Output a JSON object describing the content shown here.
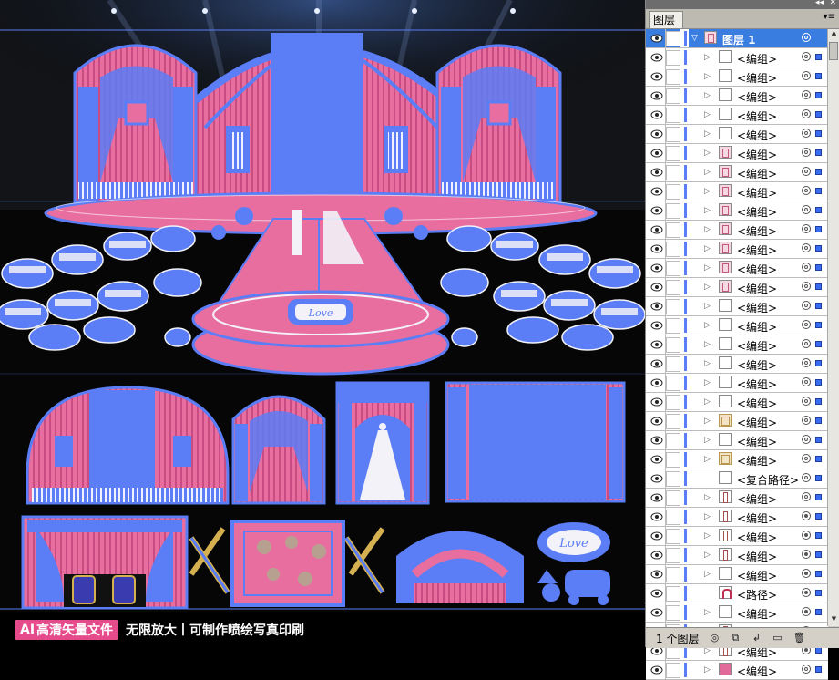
{
  "banner": {
    "badge_ai": "AI",
    "badge_text": "高清矢量文件",
    "slogan": "无限放大丨可制作喷绘写真印刷"
  },
  "colors": {
    "pink": "#e86ea0",
    "blue": "#5b7df5",
    "white": "#f2f2f8",
    "selection": "#3a7de0"
  },
  "panel": {
    "tab_label": "图层",
    "layer_count": "1 个图层",
    "selected_layer": {
      "name": "图层 1"
    },
    "rows": [
      {
        "name": "<编组>",
        "thumb": "blank",
        "expand": true,
        "target": "empty"
      },
      {
        "name": "<编组>",
        "thumb": "blank",
        "expand": true,
        "target": "empty"
      },
      {
        "name": "<编组>",
        "thumb": "blank",
        "expand": true,
        "target": "empty"
      },
      {
        "name": "<编组>",
        "thumb": "blank",
        "expand": true,
        "target": "empty"
      },
      {
        "name": "<编组>",
        "thumb": "blank",
        "expand": true,
        "target": "empty"
      },
      {
        "name": "<编组>",
        "thumb": "pink",
        "expand": true,
        "target": "empty"
      },
      {
        "name": "<编组>",
        "thumb": "pink",
        "expand": true,
        "target": "empty"
      },
      {
        "name": "<编组>",
        "thumb": "pink",
        "expand": true,
        "target": "empty"
      },
      {
        "name": "<编组>",
        "thumb": "pink",
        "expand": true,
        "target": "empty"
      },
      {
        "name": "<编组>",
        "thumb": "pink",
        "expand": true,
        "target": "empty"
      },
      {
        "name": "<编组>",
        "thumb": "pink",
        "expand": true,
        "target": "empty"
      },
      {
        "name": "<编组>",
        "thumb": "pink",
        "expand": true,
        "target": "empty"
      },
      {
        "name": "<编组>",
        "thumb": "pink",
        "expand": true,
        "target": "empty"
      },
      {
        "name": "<编组>",
        "thumb": "blank",
        "expand": true,
        "target": "empty"
      },
      {
        "name": "<编组>",
        "thumb": "blank",
        "expand": true,
        "target": "empty"
      },
      {
        "name": "<编组>",
        "thumb": "blank",
        "expand": true,
        "target": "empty"
      },
      {
        "name": "<编组>",
        "thumb": "blank",
        "expand": true,
        "target": "empty"
      },
      {
        "name": "<编组>",
        "thumb": "blank",
        "expand": true,
        "target": "empty"
      },
      {
        "name": "<编组>",
        "thumb": "blank",
        "expand": true,
        "target": "empty"
      },
      {
        "name": "<编组>",
        "thumb": "tan",
        "expand": true,
        "target": "empty"
      },
      {
        "name": "<编组>",
        "thumb": "blank",
        "expand": true,
        "target": "empty"
      },
      {
        "name": "<编组>",
        "thumb": "tan",
        "expand": true,
        "target": "empty"
      },
      {
        "name": "<复合路径>",
        "thumb": "blank",
        "expand": false,
        "target": "empty"
      },
      {
        "name": "<编组>",
        "thumb": "outline",
        "expand": true,
        "target": "empty"
      },
      {
        "name": "<编组>",
        "thumb": "outline",
        "expand": true,
        "target": "filled"
      },
      {
        "name": "<编组>",
        "thumb": "outline",
        "expand": true,
        "target": "filled"
      },
      {
        "name": "<编组>",
        "thumb": "outline",
        "expand": true,
        "target": "filled"
      },
      {
        "name": "<编组>",
        "thumb": "blank",
        "expand": true,
        "target": "filled"
      },
      {
        "name": "<路径>",
        "thumb": "arch",
        "expand": false,
        "target": "filled"
      },
      {
        "name": "<编组>",
        "thumb": "blank",
        "expand": true,
        "target": "filled"
      },
      {
        "name": "<编组>",
        "thumb": "outline",
        "expand": true,
        "target": "filled"
      },
      {
        "name": "<编组>",
        "thumb": "outline",
        "expand": true,
        "target": "filled"
      },
      {
        "name": "<编组>",
        "thumb": "pinkfull",
        "expand": true,
        "target": "empty"
      }
    ]
  }
}
